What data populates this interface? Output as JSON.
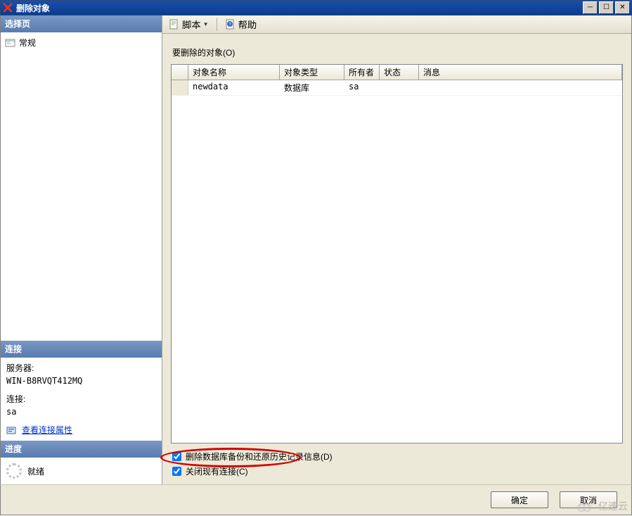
{
  "window": {
    "title": "删除对象"
  },
  "sidebar": {
    "pages_header": "选择页",
    "pages": [
      {
        "label": "常规"
      }
    ],
    "connection_header": "连接",
    "server_label": "服务器:",
    "server_value": "WIN-B8RVQT412MQ",
    "connection_label": "连接:",
    "connection_value": "sa",
    "view_props_link": "查看连接属性",
    "progress_header": "进度",
    "progress_status": "就绪"
  },
  "toolbar": {
    "script_label": "脚本",
    "help_label": "帮助"
  },
  "main": {
    "objects_label": "要删除的对象(O)",
    "columns": {
      "name": "对象名称",
      "type": "对象类型",
      "owner": "所有者",
      "state": "状态",
      "message": "消息"
    },
    "rows": [
      {
        "name": "newdata",
        "type": "数据库",
        "owner": "sa",
        "state": "",
        "message": ""
      }
    ],
    "checkbox_backup": "删除数据库备份和还原历史记录信息(D)",
    "checkbox_close_conn": "关闭现有连接(C)"
  },
  "footer": {
    "ok": "确定",
    "cancel": "取消"
  },
  "watermark": "亿速云"
}
